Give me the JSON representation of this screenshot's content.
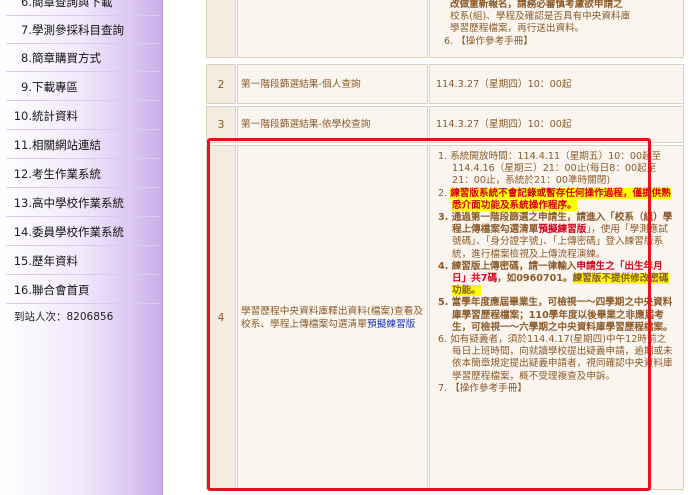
{
  "sidebar": {
    "items": [
      {
        "num": "6.",
        "label": "簡章查詢與下載"
      },
      {
        "num": "7.",
        "label": "學測參採科目查詢"
      },
      {
        "num": "8.",
        "label": "簡章購買方式"
      },
      {
        "num": "9.",
        "label": "下載專區"
      },
      {
        "num": "10.",
        "label": "統計資料"
      },
      {
        "num": "11.",
        "label": "相關網站連結"
      },
      {
        "num": "12.",
        "label": "考生作業系統"
      },
      {
        "num": "13.",
        "label": "高中學校作業系統"
      },
      {
        "num": "14.",
        "label": "委員學校作業系統"
      },
      {
        "num": "15.",
        "label": "歷年資料"
      },
      {
        "num": "16.",
        "label": "聯合會首頁"
      }
    ],
    "visitor_label": "到站人次：",
    "visitor_count": "8206856"
  },
  "table": {
    "top_partial": {
      "line1": "改做重新報名，請務必審慎考慮欲申請之",
      "line2": "校系(組)、學程及確認是否具有中央資料庫",
      "line3": "學習歷程檔案，再行送出資料。",
      "ref_num": "6.",
      "ref_label": "【操作參考手冊】"
    },
    "rows": [
      {
        "num": "2",
        "item": "第一階段篩選結果-個人查詢",
        "time": "114.3.27（星期四）10：00起"
      },
      {
        "num": "3",
        "item": "第一階段篩選結果-依學校查詢",
        "time": "114.3.27（星期四）10：00起"
      }
    ],
    "row4": {
      "num": "4",
      "item_prefix": "學習歷程中央資料庫釋出資料(檔案)查看及校系、學程上傳檔案勾選清單",
      "item_link": "預擬練習版",
      "notes": {
        "n1_num": "1.",
        "n1": "系統開放時間：114.4.11（星期五）10：00起至114.4.16（星期三）21：00止(每日8：00起至21：00止，系統於21：00準時關閉)",
        "n2_num": "2.",
        "n2": "練習版系統不會記錄或暫存任何操作過程，僅提供熟悉介面功能及系統操作程序。",
        "n3_num": "3.",
        "n3_a": "通過第一階段篩選之申請生，請進入「校系（組）學程上傳檔案勾選清單",
        "n3_b": "預擬練習版",
        "n3_c": "」，使用「學測應試號碼」、「身分證字號」、「上傳密碼」登入練習版系統，進行檔案檢視及上傳流程演練。",
        "n4_num": "4.",
        "n4_a": "練習版上傳密碼，請一律輸入",
        "n4_b": "申請生之「出生年月日」共7碼",
        "n4_c": "，如0960701。",
        "n4_d": "練習版不提供修改密碼功能。",
        "n5_num": "5.",
        "n5": "當學年度應屆畢業生，可檢視一～四學期之中央資料庫學習歷程檔案；110學年度以後畢業之非應屆考生，可檢視一～六學期之中央資料庫學習歷程檔案。",
        "n6_num": "6.",
        "n6": "如有疑義者，須於114.4.17(星期四)中午12時前之每日上班時間，向就讀學校提出疑義申請，逾期或未依本簡章規定提出疑義申請者，視同確認中央資料庫學習歷程檔案，概不受理複查及申訴。",
        "n7_num": "7.",
        "n7": "【操作參考手冊】"
      }
    }
  },
  "colors": {
    "highlight_box": "#e2131f",
    "text_brown": "#8b5b2b",
    "link_blue": "#1a35b4",
    "alert_red": "#d8001a"
  }
}
